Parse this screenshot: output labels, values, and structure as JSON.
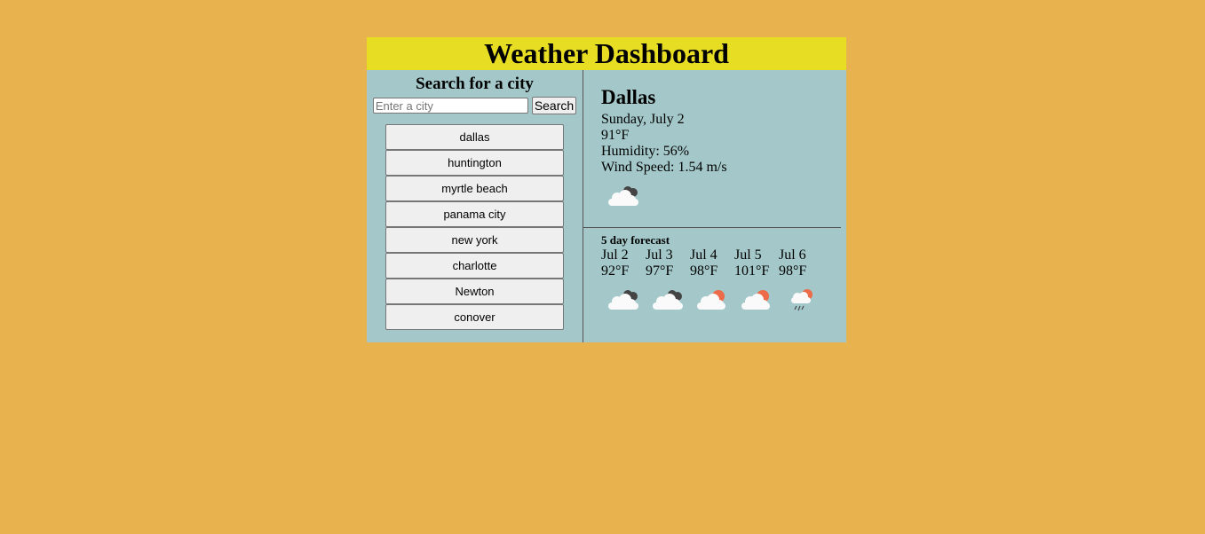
{
  "header": {
    "title": "Weather Dashboard"
  },
  "search": {
    "heading": "Search for a city",
    "placeholder": "Enter a city",
    "button_label": "Search"
  },
  "history": [
    "dallas",
    "huntington",
    "myrtle beach",
    "panama city",
    "new york",
    "charlotte",
    "Newton",
    "conover"
  ],
  "current": {
    "city": "Dallas",
    "date": "Sunday, July 2",
    "temp": "91°F",
    "humidity": "Humidity: 56%",
    "wind": "Wind Speed: 1.54 m/s",
    "icon": "dark-clouds-icon"
  },
  "forecast": {
    "title": "5 day forecast",
    "days": [
      {
        "date": "Jul 2",
        "temp": "92°F",
        "icon": "dark-clouds-icon"
      },
      {
        "date": "Jul 3",
        "temp": "97°F",
        "icon": "dark-clouds-icon"
      },
      {
        "date": "Jul 4",
        "temp": "98°F",
        "icon": "sun-cloud-icon"
      },
      {
        "date": "Jul 5",
        "temp": "101°F",
        "icon": "sun-cloud-icon"
      },
      {
        "date": "Jul 6",
        "temp": "98°F",
        "icon": "sun-rain-icon"
      }
    ]
  },
  "colors": {
    "background": "#e8b24e",
    "header": "#e7dd22",
    "panel": "#a4c8c9",
    "sun": "#ec6b48"
  }
}
